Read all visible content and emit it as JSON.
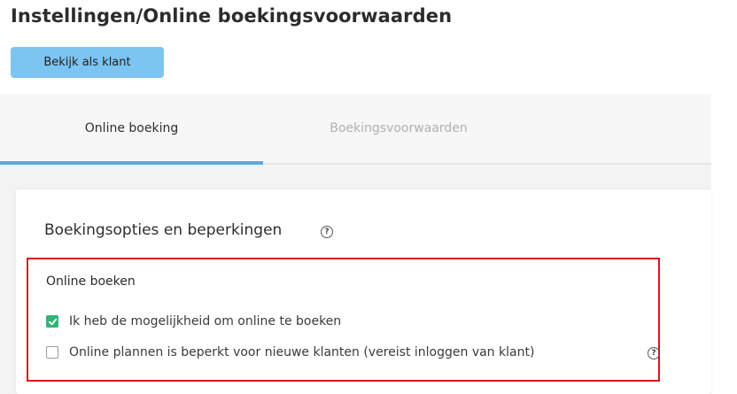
{
  "header": {
    "title": "Instellingen/Online boekingsvoorwaarden",
    "view_as_customer_label": "Bekijk als klant"
  },
  "tabs": [
    {
      "label": "Online boeking",
      "active": true
    },
    {
      "label": "Boekingsvoorwaarden",
      "active": false
    }
  ],
  "card": {
    "title": "Boekingsopties en beperkingen",
    "section_label": "Online boeken",
    "options": [
      {
        "label": "Ik heb de mogelijkheid om online te boeken",
        "checked": true
      },
      {
        "label": "Online plannen is beperkt voor nieuwe klanten (vereist inloggen van klant)",
        "checked": false
      }
    ]
  },
  "colors": {
    "accent_button": "#7cc4f2",
    "active_tab_underline": "#5aa9e6",
    "checkbox_checked": "#33b27a",
    "highlight_border": "#d7141a"
  },
  "icons": {
    "help": "question-circle-icon",
    "check": "checkmark-icon"
  }
}
